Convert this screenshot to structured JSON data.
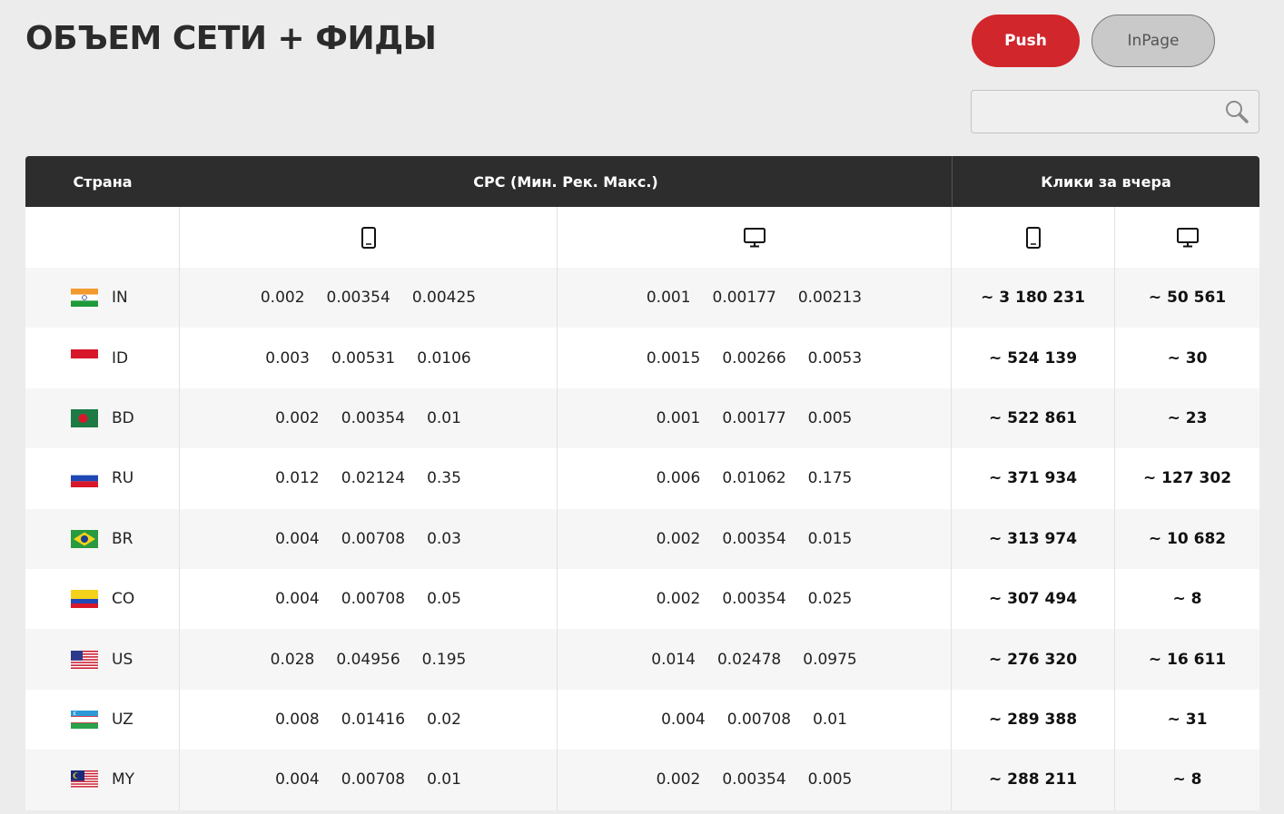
{
  "page_title": "ОБЪЕМ СЕТИ + ФИДЫ",
  "tabs": [
    {
      "label": "Push",
      "active": true
    },
    {
      "label": "InPage",
      "active": false
    }
  ],
  "search": {
    "value": "",
    "placeholder": ""
  },
  "table": {
    "headers": {
      "country": "Страна",
      "cpc": "CPC (Мин. Рек. Макс.)",
      "clicks": "Клики за вчера"
    },
    "subheader_icons": [
      "mobile-icon",
      "desktop-icon",
      "mobile-icon",
      "desktop-icon"
    ],
    "rows": [
      {
        "flag": "india-flag-icon",
        "code": "IN",
        "cpc_mobile": [
          "0.002",
          "0.00354",
          "0.00425"
        ],
        "cpc_desktop": [
          "0.001",
          "0.00177",
          "0.00213"
        ],
        "clicks_mobile": "~ 3 180 231",
        "clicks_desktop": "~ 50 561"
      },
      {
        "flag": "indonesia-flag-icon",
        "code": "ID",
        "cpc_mobile": [
          "0.003",
          "0.00531",
          "0.0106"
        ],
        "cpc_desktop": [
          "0.0015",
          "0.00266",
          "0.0053"
        ],
        "clicks_mobile": "~ 524 139",
        "clicks_desktop": "~ 30"
      },
      {
        "flag": "bangladesh-flag-icon",
        "code": "BD",
        "cpc_mobile": [
          "0.002",
          "0.00354",
          "0.01"
        ],
        "cpc_desktop": [
          "0.001",
          "0.00177",
          "0.005"
        ],
        "clicks_mobile": "~ 522 861",
        "clicks_desktop": "~ 23"
      },
      {
        "flag": "russia-flag-icon",
        "code": "RU",
        "cpc_mobile": [
          "0.012",
          "0.02124",
          "0.35"
        ],
        "cpc_desktop": [
          "0.006",
          "0.01062",
          "0.175"
        ],
        "clicks_mobile": "~ 371 934",
        "clicks_desktop": "~ 127 302"
      },
      {
        "flag": "brazil-flag-icon",
        "code": "BR",
        "cpc_mobile": [
          "0.004",
          "0.00708",
          "0.03"
        ],
        "cpc_desktop": [
          "0.002",
          "0.00354",
          "0.015"
        ],
        "clicks_mobile": "~ 313 974",
        "clicks_desktop": "~ 10 682"
      },
      {
        "flag": "colombia-flag-icon",
        "code": "CO",
        "cpc_mobile": [
          "0.004",
          "0.00708",
          "0.05"
        ],
        "cpc_desktop": [
          "0.002",
          "0.00354",
          "0.025"
        ],
        "clicks_mobile": "~ 307 494",
        "clicks_desktop": "~ 8"
      },
      {
        "flag": "usa-flag-icon",
        "code": "US",
        "cpc_mobile": [
          "0.028",
          "0.04956",
          "0.195"
        ],
        "cpc_desktop": [
          "0.014",
          "0.02478",
          "0.0975"
        ],
        "clicks_mobile": "~ 276 320",
        "clicks_desktop": "~ 16 611"
      },
      {
        "flag": "uzbekistan-flag-icon",
        "code": "UZ",
        "cpc_mobile": [
          "0.008",
          "0.01416",
          "0.02"
        ],
        "cpc_desktop": [
          "0.004",
          "0.00708",
          "0.01"
        ],
        "clicks_mobile": "~ 289 388",
        "clicks_desktop": "~ 31"
      },
      {
        "flag": "malaysia-flag-icon",
        "code": "MY",
        "cpc_mobile": [
          "0.004",
          "0.00708",
          "0.01"
        ],
        "cpc_desktop": [
          "0.002",
          "0.00354",
          "0.005"
        ],
        "clicks_mobile": "~ 288 211",
        "clicks_desktop": "~ 8"
      }
    ]
  },
  "colors": {
    "accent": "#d1262c",
    "header_bg": "#2d2d2d",
    "page_bg": "#ececec"
  }
}
